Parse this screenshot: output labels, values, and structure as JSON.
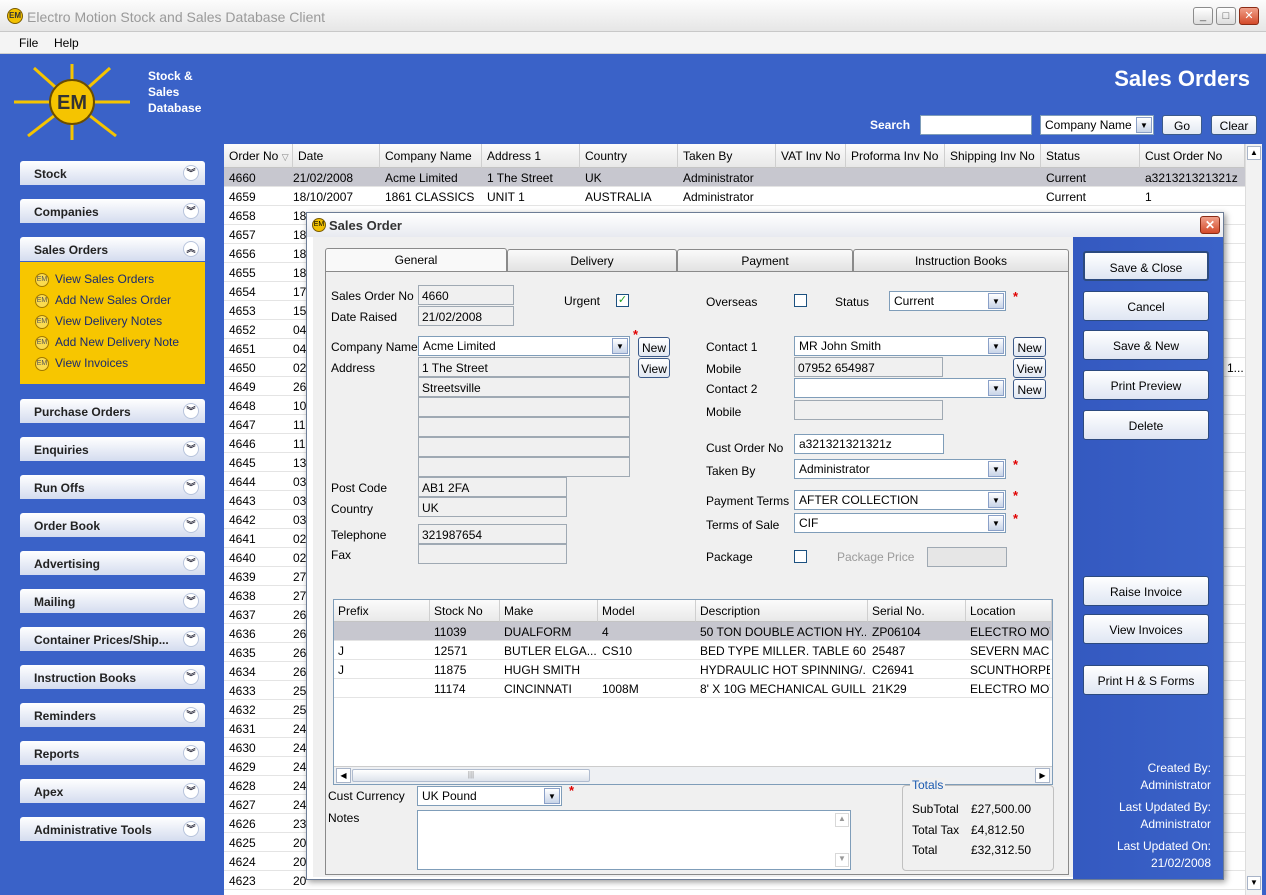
{
  "window": {
    "title": "Electro Motion Stock and Sales Database Client"
  },
  "menu": [
    "File",
    "Help"
  ],
  "banner": {
    "app_name_lines": [
      "Stock &",
      "Sales",
      "Database"
    ],
    "logo_text": "EM",
    "page_title": "Sales Orders",
    "search_label": "Search",
    "search_value": "",
    "search_field": "Company Name",
    "go_label": "Go",
    "clear_label": "Clear"
  },
  "sidebar": {
    "groups": [
      "Stock",
      "Companies",
      "Sales Orders",
      "Purchase Orders",
      "Enquiries",
      "Run Offs",
      "Order Book",
      "Advertising",
      "Mailing",
      "Container Prices/Ship...",
      "Instruction Books",
      "Reminders",
      "Reports",
      "Apex",
      "Administrative Tools"
    ],
    "sales_items": [
      "View Sales Orders",
      "Add New Sales Order",
      "View Delivery Notes",
      "Add New Delivery Note",
      "View Invoices"
    ]
  },
  "grid": {
    "columns": [
      "Order No",
      "Date",
      "Company Name",
      "Address 1",
      "Country",
      "Taken By",
      "VAT Inv No",
      "Proforma Inv No",
      "Shipping Inv No",
      "Status",
      "Cust Order No"
    ],
    "rows": [
      [
        "4660",
        "21/02/2008",
        "Acme Limited",
        "1 The Street",
        "UK",
        "Administrator",
        "",
        "",
        "",
        "Current",
        "a321321321321z"
      ],
      [
        "4659",
        "18/10/2007",
        "1861 CLASSICS",
        "UNIT 1",
        "AUSTRALIA",
        "Administrator",
        "",
        "",
        "",
        "Current",
        "1"
      ]
    ],
    "order_numbers": [
      "4658",
      "4657",
      "4656",
      "4655",
      "4654",
      "4653",
      "4652",
      "4651",
      "4650",
      "4649",
      "4648",
      "4647",
      "4646",
      "4645",
      "4644",
      "4643",
      "4642",
      "4641",
      "4640",
      "4639",
      "4638",
      "4637",
      "4636",
      "4635",
      "4634",
      "4633",
      "4632",
      "4631",
      "4630",
      "4629",
      "4628",
      "4627",
      "4626",
      "4625",
      "4624",
      "4623"
    ],
    "date_fragments": [
      "18",
      "18",
      "18",
      "18",
      "17",
      "15",
      "04",
      "04",
      "02",
      "26",
      "10",
      "11",
      "11",
      "13",
      "03",
      "03",
      "03",
      "02",
      "02",
      "27",
      "27",
      "26",
      "26",
      "26",
      "26",
      "25",
      "25",
      "24",
      "24",
      "24",
      "24",
      "24",
      "23",
      "20",
      "20",
      "20"
    ],
    "row_4650_overflow": "1..."
  },
  "dialog": {
    "title": "Sales Order",
    "tabs": [
      "General",
      "Delivery",
      "Payment",
      "Instruction Books"
    ],
    "sales_order_no_label": "Sales Order No",
    "sales_order_no": "4660",
    "date_raised_label": "Date Raised",
    "date_raised": "21/02/2008",
    "urgent_label": "Urgent",
    "urgent_mark": "✓",
    "overseas_label": "Overseas",
    "status_label": "Status",
    "status": "Current",
    "company_name_label": "Company Name",
    "company_name": "Acme Limited",
    "new_label": "New",
    "view_label": "View",
    "address_label": "Address",
    "address_lines": [
      "1 The Street",
      "Streetsville",
      "",
      "",
      "",
      ""
    ],
    "post_code_label": "Post Code",
    "post_code": "AB1 2FA",
    "country_label": "Country",
    "country": "UK",
    "telephone_label": "Telephone",
    "telephone": "321987654",
    "fax_label": "Fax",
    "fax": "",
    "contact1_label": "Contact 1",
    "contact1": "MR John Smith",
    "mobile_label": "Mobile",
    "mobile1": "07952 654987",
    "contact2_label": "Contact 2",
    "contact2": "",
    "mobile2": "",
    "cust_order_no_label": "Cust Order No",
    "cust_order_no": "a321321321321z",
    "taken_by_label": "Taken By",
    "taken_by": "Administrator",
    "payment_terms_label": "Payment Terms",
    "payment_terms": "AFTER COLLECTION",
    "terms_of_sale_label": "Terms of Sale",
    "terms_of_sale": "CIF",
    "package_label": "Package",
    "package_price_label": "Package Price",
    "items": {
      "columns": [
        "Prefix",
        "Stock No",
        "Make",
        "Model",
        "Description",
        "Serial No.",
        "Location"
      ],
      "rows": [
        [
          "",
          "11039",
          "DUALFORM",
          "4",
          "50 TON DOUBLE ACTION HY...",
          "ZP06104",
          "ELECTRO MOT"
        ],
        [
          "J",
          "12571",
          "BUTLER ELGA...",
          "CS10",
          "BED TYPE MILLER. TABLE 60...",
          "25487",
          "SEVERN MACH"
        ],
        [
          "J",
          "11875",
          "HUGH SMITH",
          "",
          "HYDRAULIC HOT SPINNING/...",
          "C26941",
          "SCUNTHORPE"
        ],
        [
          "",
          "11174",
          "CINCINNATI",
          "1008M",
          "8' X 10G MECHANICAL GUILL...",
          "21K29",
          "ELECTRO MOT"
        ]
      ]
    },
    "cust_currency_label": "Cust Currency",
    "cust_currency": "UK Pound",
    "notes_label": "Notes",
    "notes": "",
    "totals": {
      "legend": "Totals",
      "subtotal_label": "SubTotal",
      "subtotal": "£27,500.00",
      "tax_label": "Total Tax",
      "tax": "£4,812.50",
      "total_label": "Total",
      "total": "£32,312.50"
    },
    "buttons": [
      "Save & Close",
      "Cancel",
      "Save & New",
      "Print Preview",
      "Delete",
      "Raise Invoice",
      "View Invoices",
      "Print H & S Forms"
    ],
    "created_by_label": "Created By:",
    "created_by": "Administrator",
    "last_updated_by_label": "Last Updated By:",
    "last_updated_by": "Administrator",
    "last_updated_on_label": "Last Updated On:",
    "last_updated_on": "21/02/2008"
  }
}
